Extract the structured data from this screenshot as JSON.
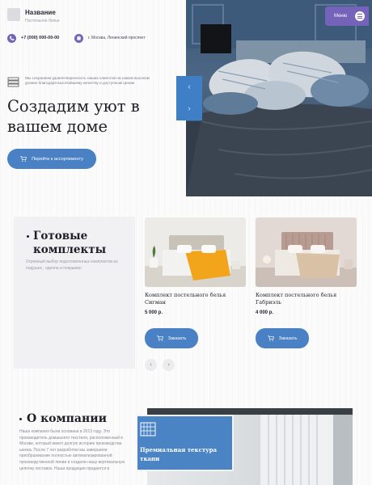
{
  "header": {
    "brand_name": "Название",
    "brand_sub": "Постельное белье",
    "phone": "+7 (000) 000-00-00",
    "address": "г. Москва, Ленинский проспект",
    "menu_label": "Меню"
  },
  "hero": {
    "description": "Мы сохраняем удовлетворенность наших клиентов на самом высоком уровне благодаря высочайшему качеству и доступным ценам",
    "title": "Создадим уют в вашем доме",
    "cta_label": "Перейти к ассортименту",
    "prev_arrow": "‹",
    "next_arrow": "›"
  },
  "ready": {
    "title": "Готовые комплекты",
    "description": "Огромный выбор подготовленных комплектов из подушек , одеяла и покрывал"
  },
  "products": [
    {
      "name": "Комплект постельного белья Сигман",
      "price": "5 000 р.",
      "button": "Заказать"
    },
    {
      "name": "Комплект постельного белья Габриэль",
      "price": "4 000 р.",
      "button": "Заказать"
    }
  ],
  "carousel": {
    "prev": "‹",
    "next": "›"
  },
  "about": {
    "title": "О компании",
    "text": "Наша компания была основана в 2013 году. Это производитель домашнего текстиля, расположенный в Москве, который имеет долгую историю производства шелка. После 7 лет разработки мы завершили преобразование полностью автоматизированной производственной линии и создали нашу вертикальную цепочку поставок. Наша продукция продается в",
    "card_title": "Премиальная текстура ткани"
  },
  "colors": {
    "accent_blue": "#4a81c4",
    "accent_purple": "#7563b9"
  },
  "icons": [
    "logo-placeholder",
    "phone-icon",
    "location-icon",
    "menu-icon",
    "bed-stack-icon",
    "cart-icon",
    "fabric-icon"
  ]
}
